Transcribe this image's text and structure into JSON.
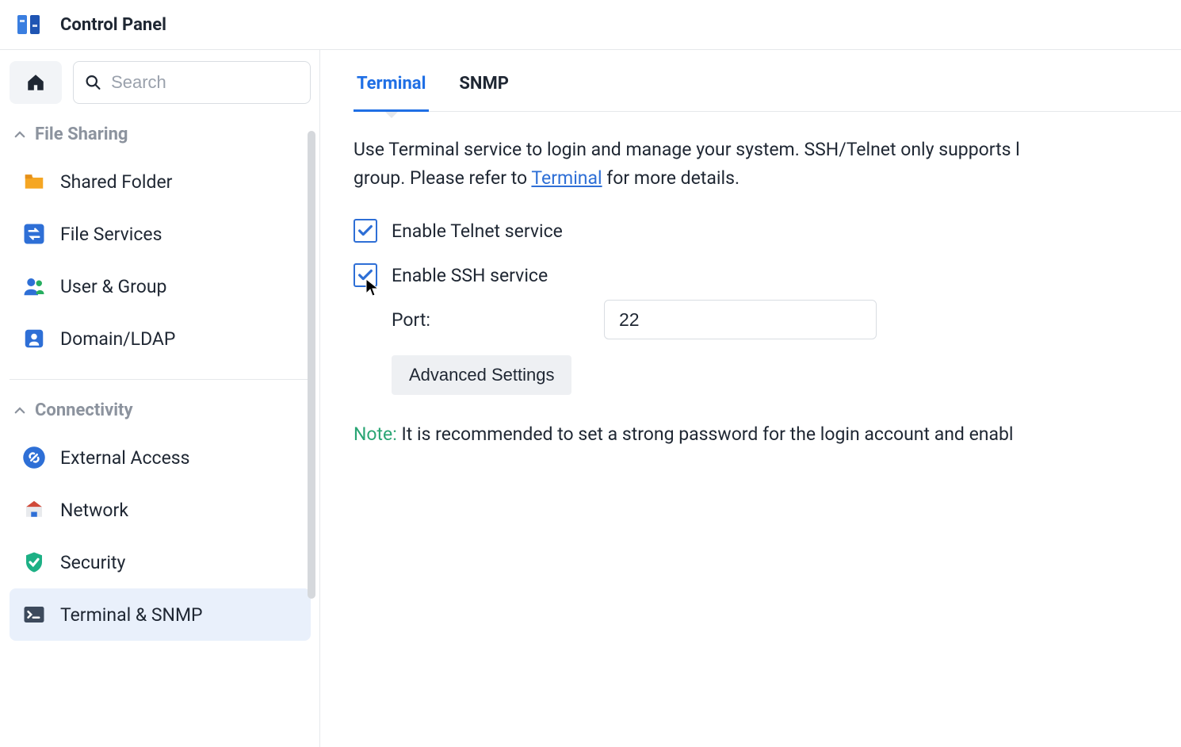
{
  "header": {
    "title": "Control Panel"
  },
  "search": {
    "placeholder": "Search"
  },
  "sections": {
    "fileSharing": {
      "label": "File Sharing"
    },
    "connectivity": {
      "label": "Connectivity"
    }
  },
  "sidebar": {
    "sharedFolder": "Shared Folder",
    "fileServices": "File Services",
    "userGroup": "User & Group",
    "domainLdap": "Domain/LDAP",
    "externalAccess": "External Access",
    "network": "Network",
    "security": "Security",
    "terminalSnmp": "Terminal & SNMP"
  },
  "tabs": {
    "terminal": "Terminal",
    "snmp": "SNMP"
  },
  "main": {
    "desc_before": "Use Terminal service to login and manage your system. SSH/Telnet only supports l",
    "desc_group": "group. Please refer to ",
    "desc_link": "Terminal",
    "desc_after": " for more details.",
    "telnet_label": "Enable Telnet service",
    "ssh_label": "Enable SSH service",
    "port_label": "Port:",
    "port_value": "22",
    "advanced_btn": "Advanced Settings",
    "note_label": "Note:",
    "note_text": " It is recommended to set a strong password for the login account and enabl"
  }
}
